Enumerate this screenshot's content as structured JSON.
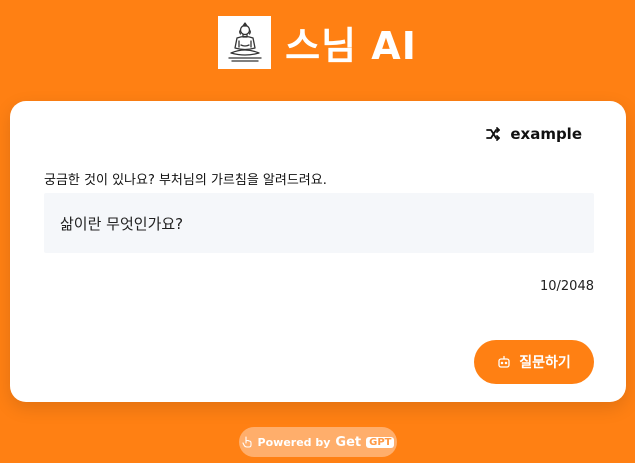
{
  "header": {
    "title": "스님 AI",
    "logo_icon": "buddha-meditating-icon"
  },
  "card": {
    "example_label": "example",
    "example_icon": "shuffle-icon",
    "prompt_label": "궁금한 것이 있나요? 부처님의 가르침을 알려드려요.",
    "question_value": "삶이란 무엇인가요?",
    "char_count": "10/2048",
    "ask_button_label": "질문하기",
    "ask_button_icon": "robot-icon"
  },
  "footer": {
    "powered_by": "Powered by",
    "brand_get": "Get",
    "brand_gpt": "GPT",
    "icon": "hand-pointer-icon"
  },
  "colors": {
    "background": "#FF8013",
    "card": "#FFFFFF",
    "input_bg": "#F5F7FA",
    "button": "#FF8013"
  }
}
